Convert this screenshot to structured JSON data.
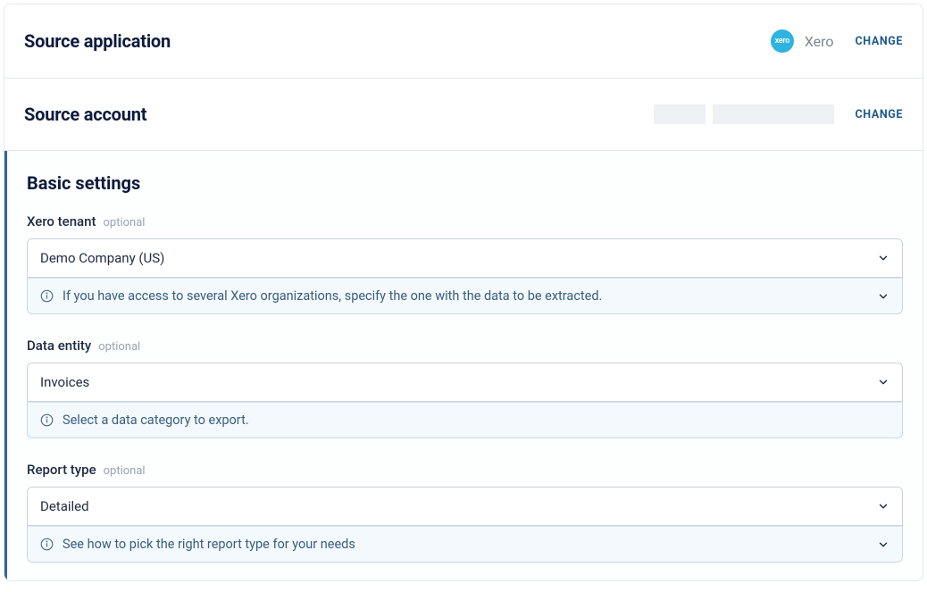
{
  "sourceApplication": {
    "title": "Source application",
    "appName": "Xero",
    "logoText": "xero",
    "changeLabel": "CHANGE"
  },
  "sourceAccount": {
    "title": "Source account",
    "changeLabel": "CHANGE"
  },
  "basicSettings": {
    "title": "Basic settings",
    "optionalLabel": "optional",
    "fields": {
      "xeroTenant": {
        "label": "Xero tenant",
        "value": "Demo Company (US)",
        "hint": "If you have access to several Xero organizations, specify the one with the data to be extracted."
      },
      "dataEntity": {
        "label": "Data entity",
        "value": "Invoices",
        "hint": "Select a data category to export."
      },
      "reportType": {
        "label": "Report type",
        "value": "Detailed",
        "hint": "See how to pick the right report type for your needs"
      }
    }
  }
}
